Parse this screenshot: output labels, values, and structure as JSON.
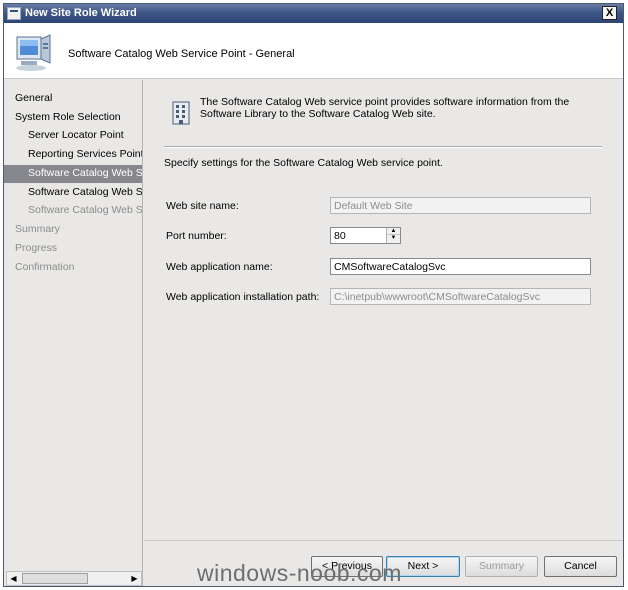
{
  "window": {
    "title": "New Site Role Wizard",
    "close_label": "X"
  },
  "header": {
    "title": "Software Catalog Web Service Point - General"
  },
  "sidebar": {
    "items": [
      {
        "label": "General",
        "level": 0,
        "state": "normal"
      },
      {
        "label": "System Role Selection",
        "level": 0,
        "state": "normal"
      },
      {
        "label": "Server Locator Point",
        "level": 1,
        "state": "normal"
      },
      {
        "label": "Reporting Services Point",
        "level": 1,
        "state": "normal"
      },
      {
        "label": "Software Catalog Web Ser",
        "level": 1,
        "state": "selected"
      },
      {
        "label": "Software Catalog Web Ser",
        "level": 1,
        "state": "normal"
      },
      {
        "label": "Software Catalog Web Site",
        "level": 1,
        "state": "dim"
      },
      {
        "label": "Summary",
        "level": 0,
        "state": "dim"
      },
      {
        "label": "Progress",
        "level": 0,
        "state": "dim"
      },
      {
        "label": "Confirmation",
        "level": 0,
        "state": "dim"
      }
    ]
  },
  "main": {
    "info_text": "The Software Catalog Web service point provides software information from the Software Library to the Software Catalog Web site.",
    "instructions": "Specify settings for the Software Catalog Web service point.",
    "fields": {
      "website_name": {
        "label": "Web site name:",
        "value": "Default Web Site"
      },
      "port_number": {
        "label": "Port number:",
        "value": "80"
      },
      "app_name": {
        "label": "Web application name:",
        "value": "CMSoftwareCatalogSvc"
      },
      "install_path": {
        "label": "Web application installation path:",
        "value": "C:\\inetpub\\wwwroot\\CMSoftwareCatalogSvc"
      }
    }
  },
  "footer": {
    "previous_label": "< Previous",
    "next_label": "Next >",
    "summary_label": "Summary",
    "cancel_label": "Cancel"
  },
  "watermark": "windows-noob.com"
}
